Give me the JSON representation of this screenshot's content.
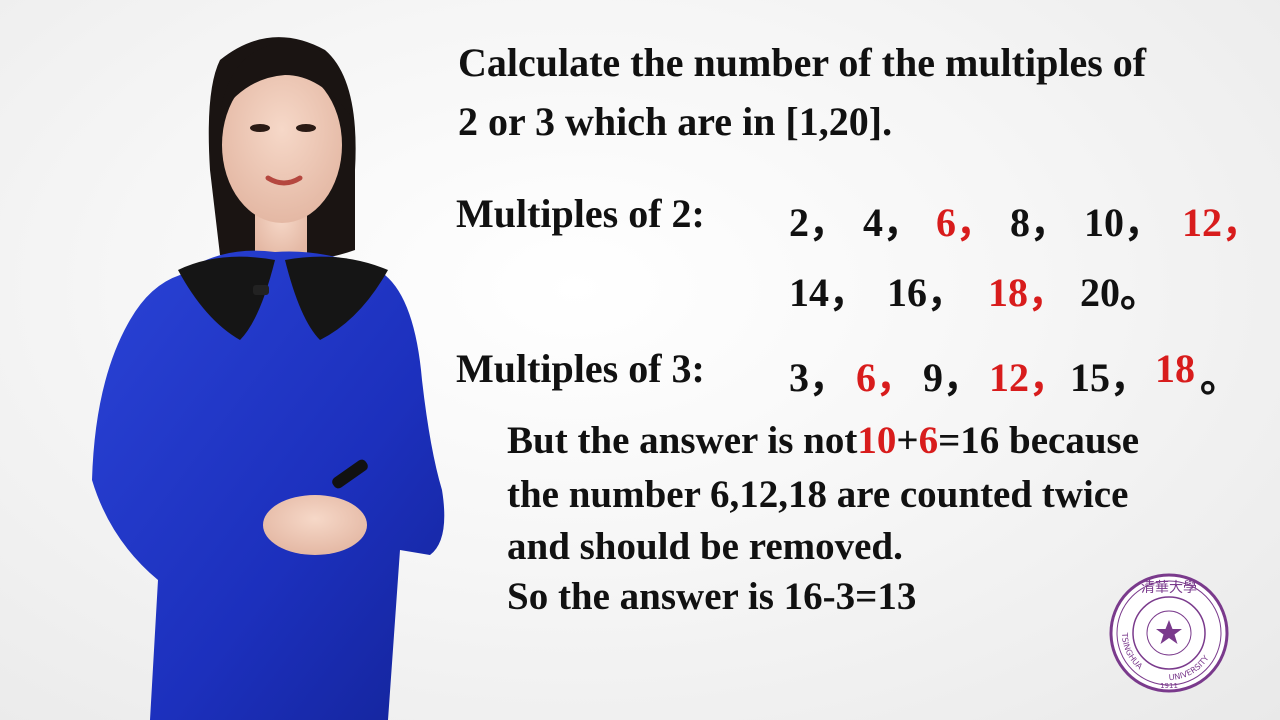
{
  "question": {
    "line1": "Calculate the number of the multiples of",
    "line2": "2 or 3 which are in [1,20]."
  },
  "multiples_of_2": {
    "label": "Multiples of 2:",
    "row1": [
      {
        "text": "2，",
        "highlight": false
      },
      {
        "text": "4，",
        "highlight": false
      },
      {
        "text": "6，",
        "highlight": true
      },
      {
        "text": "8，",
        "highlight": false
      },
      {
        "text": "10，",
        "highlight": false
      },
      {
        "text": "12，",
        "highlight": true
      }
    ],
    "row2": [
      {
        "text": "14，",
        "highlight": false
      },
      {
        "text": "16，",
        "highlight": false
      },
      {
        "text": "18，",
        "highlight": true
      },
      {
        "text": "20。",
        "highlight": false
      }
    ]
  },
  "multiples_of_3": {
    "label": "Multiples of 3:",
    "row": [
      {
        "text": "3，",
        "highlight": false
      },
      {
        "text": "6，",
        "highlight": true
      },
      {
        "text": "9，",
        "highlight": false
      },
      {
        "text": "12，",
        "highlight": true
      },
      {
        "text": "15，",
        "highlight": false
      },
      {
        "text": "18",
        "highlight": true
      },
      {
        "text": "。",
        "highlight": false
      }
    ]
  },
  "explanation": {
    "line1_pre": "But the answer is not",
    "line1_a": "10",
    "line1_plus": "+",
    "line1_b": "6",
    "line1_post": "=16 because",
    "line2": "the number 6,12,18 are counted twice",
    "line3": "and should be removed.",
    "line4": "So the answer is 16-3=13"
  },
  "seal": {
    "chinese": "清華大學",
    "english_left": "TSINGHUA",
    "english_right": "UNIVERSITY",
    "year": "1911"
  },
  "colors": {
    "text": "#111111",
    "highlight": "#d81c1c",
    "dress": "#1f35c8",
    "seal": "#7a3a8c"
  }
}
